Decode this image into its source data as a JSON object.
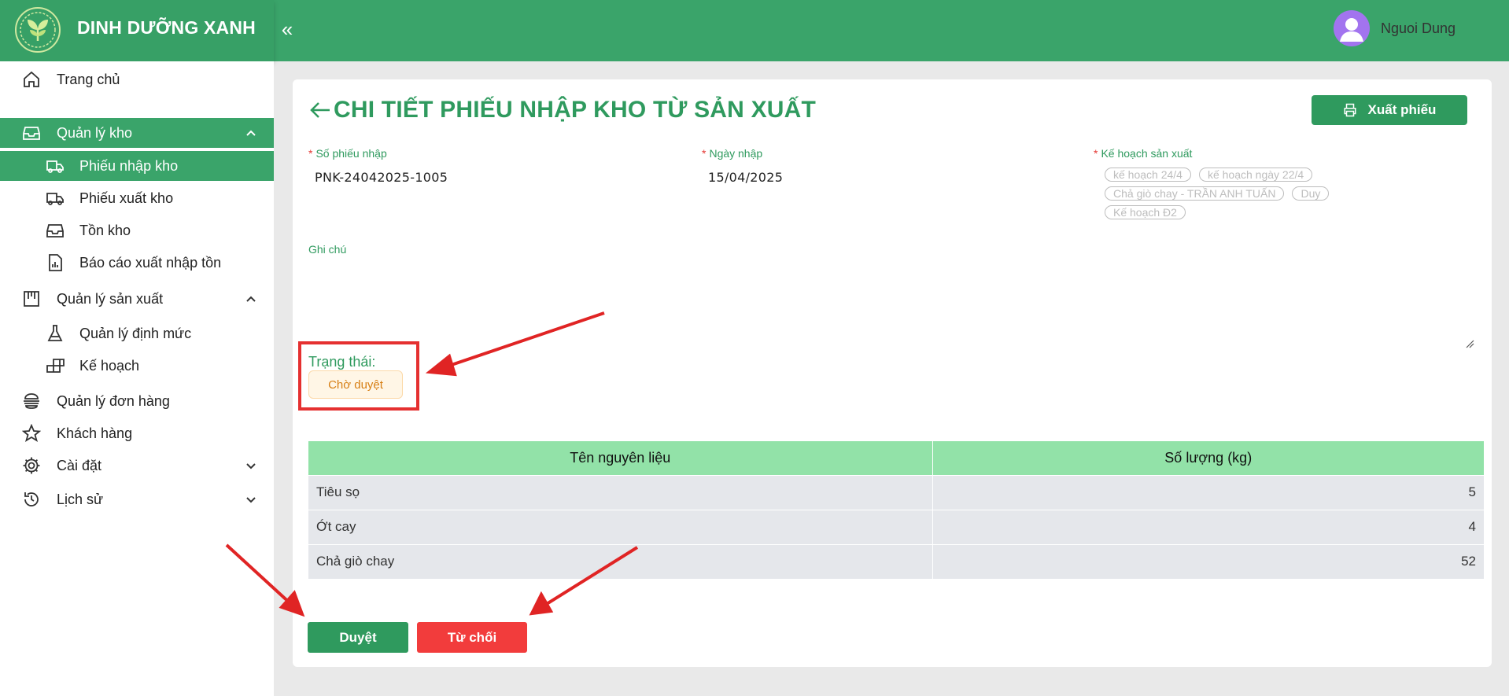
{
  "header": {
    "brand_name": "DINH DƯỠNG XANH",
    "collapse_glyph": "«",
    "user_name": "Nguoi Dung",
    "colors": {
      "header": "#3aa46a",
      "accent": "#2f9a5e",
      "danger": "#f23c3c",
      "avatar": "#a274ef"
    }
  },
  "sidebar": {
    "items": [
      {
        "label": "Trang chủ",
        "icon": "home-icon"
      },
      {
        "label": "Quản lý kho",
        "icon": "inbox-icon",
        "expanded": true
      },
      {
        "label": "Phiếu nhập kho",
        "icon": "truck-icon",
        "active": true
      },
      {
        "label": "Phiếu xuất kho",
        "icon": "truck-icon"
      },
      {
        "label": "Tồn kho",
        "icon": "inbox-icon"
      },
      {
        "label": "Báo cáo xuất nhập tồn",
        "icon": "report-icon"
      },
      {
        "label": "Quản lý sản xuất",
        "icon": "factory-icon",
        "expanded": true
      },
      {
        "label": "Quản lý định mức",
        "icon": "flask-icon"
      },
      {
        "label": "Kế hoạch",
        "icon": "blocks-icon"
      },
      {
        "label": "Quản lý đơn hàng",
        "icon": "orders-icon"
      },
      {
        "label": "Khách hàng",
        "icon": "star-icon"
      },
      {
        "label": "Cài đặt",
        "icon": "gear-icon",
        "expanded": false
      },
      {
        "label": "Lịch sử",
        "icon": "clock-icon",
        "expanded": false
      }
    ]
  },
  "main": {
    "title": "CHI TIẾT PHIẾU NHẬP KHO TỪ SẢN XUẤT",
    "export_label": "Xuất phiếu",
    "fields": {
      "receipt_no_label": "Số phiếu nhập",
      "receipt_no_value": "PNK-24042025-1005",
      "date_label": "Ngày nhập",
      "date_value": "15/04/2025",
      "plan_label": "Kế hoạch sản xuất",
      "plan_tags": [
        "kế hoạch 24/4",
        "kế hoạch ngày 22/4",
        "Chả giò chay - TRẦN ANH TUẤN",
        "Duy",
        "Kế hoạch Đ2"
      ],
      "note_label": "Ghi chú"
    },
    "status": {
      "label": "Trạng thái:",
      "value": "Chờ duyệt"
    },
    "table": {
      "headers": [
        "Tên nguyên liệu",
        "Số lượng (kg)"
      ],
      "rows": [
        [
          "Tiêu sọ",
          "5"
        ],
        [
          "Ớt cay",
          "4"
        ],
        [
          "Chả giò chay",
          "52"
        ]
      ]
    },
    "approve_label": "Duyệt",
    "reject_label": "Từ chối"
  }
}
